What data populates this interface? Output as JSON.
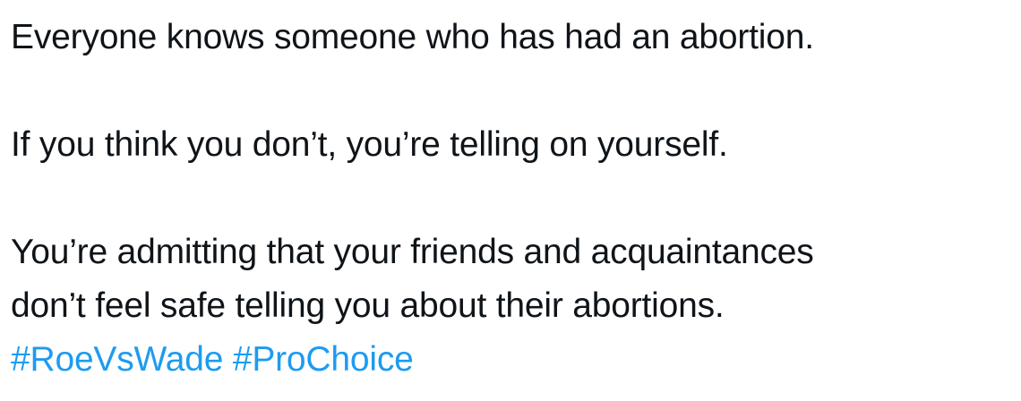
{
  "tweet": {
    "paragraph1": "Everyone knows someone who has had an abortion.",
    "paragraph2": "If you think you don’t, you’re telling on yourself.",
    "paragraph3_line1": "You’re admitting that your friends and acquaintances",
    "paragraph3_line2": "don’t feel safe telling you about their abortions.",
    "hashtags": [
      "#RoeVsWade",
      "#ProChoice"
    ],
    "colors": {
      "text": "#0f1419",
      "hashtag": "#1d9bf0",
      "background": "#ffffff"
    }
  }
}
